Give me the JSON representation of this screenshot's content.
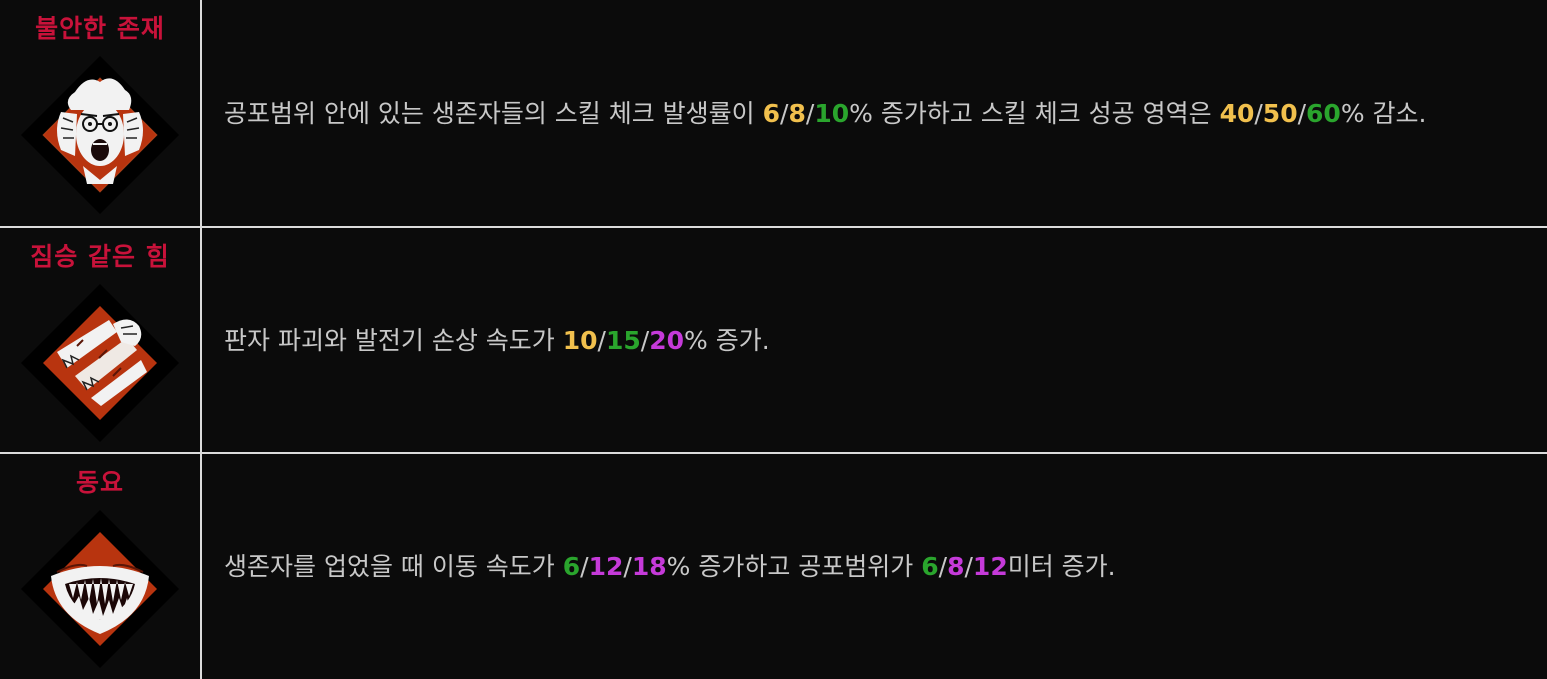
{
  "colors": {
    "name": "#c8123a",
    "text": "#c8c8c8",
    "tier1": "#f1c04d",
    "tier2": "#2aa52d",
    "tier3": "#c53ad9",
    "icon_fill": "#b8340f",
    "background": "#0b0b0b",
    "divider": "#dcdcdc"
  },
  "perks": [
    {
      "name": "불안한 존재",
      "icon": "screaming-face-icon",
      "segments": [
        {
          "t": "text",
          "v": "공포범위 안에 있는 생존자들의 스킬 체크 발생률이 "
        },
        {
          "t": "y",
          "v": "6"
        },
        {
          "t": "s",
          "v": "/"
        },
        {
          "t": "y",
          "v": "8"
        },
        {
          "t": "s",
          "v": "/"
        },
        {
          "t": "g",
          "v": "10"
        },
        {
          "t": "text",
          "v": "% 증가하고 스킬 체크 성공 영역은 "
        },
        {
          "t": "y",
          "v": "40"
        },
        {
          "t": "s",
          "v": "/"
        },
        {
          "t": "y",
          "v": "50"
        },
        {
          "t": "s",
          "v": "/"
        },
        {
          "t": "g",
          "v": "60"
        },
        {
          "t": "text",
          "v": "% 감소."
        }
      ]
    },
    {
      "name": "짐승 같은 힘",
      "icon": "smashed-wood-icon",
      "segments": [
        {
          "t": "text",
          "v": "판자 파괴와 발전기 손상 속도가 "
        },
        {
          "t": "y",
          "v": "10"
        },
        {
          "t": "s",
          "v": "/"
        },
        {
          "t": "g",
          "v": "15"
        },
        {
          "t": "s",
          "v": "/"
        },
        {
          "t": "p",
          "v": "20"
        },
        {
          "t": "text",
          "v": "% 증가."
        }
      ]
    },
    {
      "name": "동요",
      "icon": "fanged-mouth-icon",
      "segments": [
        {
          "t": "text",
          "v": "생존자를 업었을 때 이동 속도가 "
        },
        {
          "t": "g",
          "v": "6"
        },
        {
          "t": "s",
          "v": "/"
        },
        {
          "t": "p",
          "v": "12"
        },
        {
          "t": "s",
          "v": "/"
        },
        {
          "t": "p",
          "v": "18"
        },
        {
          "t": "text",
          "v": "% 증가하고 공포범위가 "
        },
        {
          "t": "g",
          "v": "6"
        },
        {
          "t": "s",
          "v": "/"
        },
        {
          "t": "p",
          "v": "8"
        },
        {
          "t": "s",
          "v": "/"
        },
        {
          "t": "p",
          "v": "12"
        },
        {
          "t": "text",
          "v": "미터 증가."
        }
      ]
    }
  ]
}
